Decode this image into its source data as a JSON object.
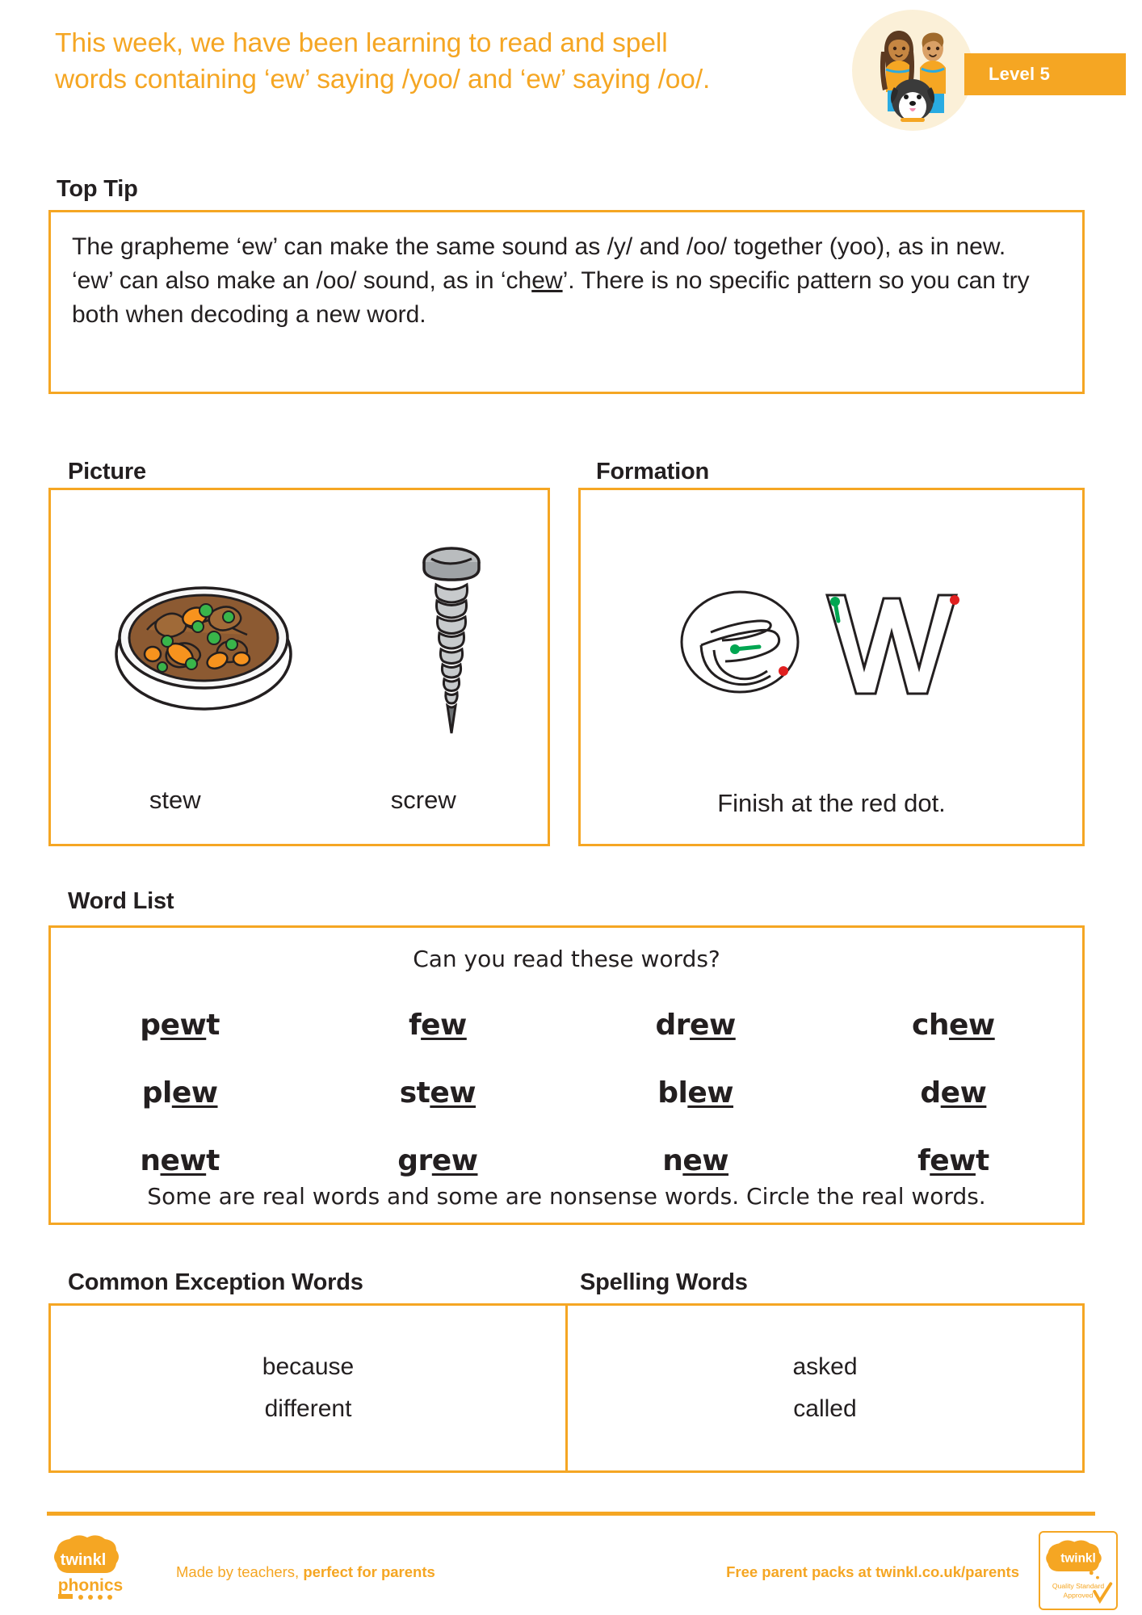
{
  "header": {
    "title_line1": "This week, we have been learning to read and spell",
    "title_line2": "words containing ‘ew’ saying /yoo/ and ‘ew’ saying /oo/.",
    "level_badge": "Level 5",
    "illustration": "two-children-and-dog-illustration"
  },
  "top_tip": {
    "heading": "Top Tip",
    "line1": "The grapheme ‘ew’ can make the same sound as /y/ and /oo/ together (yoo), as in new.",
    "line2_before": "‘ew’ can also make an /oo/ sound, as in ‘ch",
    "line2_underlined": "ew",
    "line2_after": "’. There is no specific pattern so you can try both when decoding a new word."
  },
  "picture": {
    "heading": "Picture",
    "items": [
      {
        "label": "stew",
        "icon": "bowl-of-stew-illustration"
      },
      {
        "label": "screw",
        "icon": "screw-illustration"
      }
    ]
  },
  "formation": {
    "heading": "Formation",
    "letters": "ew",
    "caption": "Finish at the red dot.",
    "start_marker_color": "#00a651",
    "end_marker_color": "#e02020"
  },
  "word_list": {
    "heading": "Word List",
    "prompt": "Can you read these words?",
    "footnote": "Some are real words and some are nonsense words. Circle the real words.",
    "rows": [
      [
        {
          "prefix": "p",
          "grapheme": "ew",
          "suffix": "t"
        },
        {
          "prefix": "f",
          "grapheme": "ew",
          "suffix": ""
        },
        {
          "prefix": "dr",
          "grapheme": "ew",
          "suffix": ""
        },
        {
          "prefix": "ch",
          "grapheme": "ew",
          "suffix": ""
        }
      ],
      [
        {
          "prefix": "pl",
          "grapheme": "ew",
          "suffix": ""
        },
        {
          "prefix": "st",
          "grapheme": "ew",
          "suffix": ""
        },
        {
          "prefix": "bl",
          "grapheme": "ew",
          "suffix": ""
        },
        {
          "prefix": "d",
          "grapheme": "ew",
          "suffix": ""
        }
      ],
      [
        {
          "prefix": "n",
          "grapheme": "ew",
          "suffix": "t"
        },
        {
          "prefix": "gr",
          "grapheme": "ew",
          "suffix": ""
        },
        {
          "prefix": "n",
          "grapheme": "ew",
          "suffix": ""
        },
        {
          "prefix": "f",
          "grapheme": "ew",
          "suffix": "t"
        }
      ]
    ]
  },
  "common_exception_words": {
    "heading": "Common Exception Words",
    "words": [
      "because",
      "different"
    ]
  },
  "spelling_words": {
    "heading": "Spelling Words",
    "words": [
      "asked",
      "called"
    ]
  },
  "footer": {
    "logo_top": "twinkl",
    "logo_bottom": "phonics",
    "tagline_plain": "Made by teachers,",
    "tagline_bold": "perfect for parents",
    "link": "Free parent packs at twinkl.co.uk/parents",
    "badge_brand": "twinkl",
    "badge_line1": "Quality Standard",
    "badge_line2": "Approved"
  },
  "colors": {
    "accent": "#f5a623",
    "text": "#231f20",
    "green": "#00a651",
    "red": "#e02020"
  }
}
